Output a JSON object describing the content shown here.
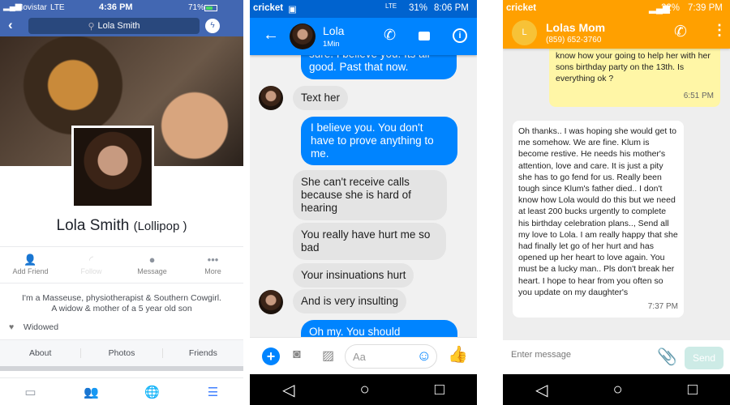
{
  "facebook": {
    "status": {
      "carrier": "Movistar",
      "network": "LTE",
      "time": "4:36 PM",
      "battery": "71%"
    },
    "search": "Lola Smith",
    "profile": {
      "name": "Lola Smith",
      "nickname": "(Lollipop )",
      "bio_line1": "I'm a Masseuse, physiotherapist & Southern Cowgirl.",
      "bio_line2": "A widow & mother of a 5 year old son",
      "relationship": "Widowed"
    },
    "actions": [
      {
        "label": "Add Friend",
        "icon": "add-friend-icon"
      },
      {
        "label": "Follow",
        "icon": "follow-icon"
      },
      {
        "label": "Message",
        "icon": "messenger-icon"
      },
      {
        "label": "More",
        "icon": "more-icon"
      }
    ],
    "tabs": [
      "About",
      "Photos",
      "Friends"
    ],
    "accent": "#4267b2"
  },
  "messenger": {
    "status": {
      "carrier": "cricket",
      "network": "LTE",
      "battery": "31%",
      "time": "8:06 PM"
    },
    "contact": {
      "name": "Lola",
      "presence": "1Min"
    },
    "messages": [
      {
        "from": "me",
        "text": "sure. I believe you. Its all good. Past that now."
      },
      {
        "from": "them",
        "text": "Text her"
      },
      {
        "from": "me",
        "text": "I believe you. You don't have to prove anything to me."
      },
      {
        "from": "them",
        "text": "She can't receive calls because she is hard of hearing"
      },
      {
        "from": "them",
        "text": "You really have hurt me so bad"
      },
      {
        "from": "them",
        "text": "Your insinuations hurt"
      },
      {
        "from": "them",
        "text": "And is very insulting"
      },
      {
        "from": "me",
        "text": "Oh my. You should"
      }
    ],
    "composer_placeholder": "Aa",
    "accent": "#0084ff"
  },
  "sms": {
    "status": {
      "carrier": "cricket",
      "battery": "22%",
      "time": "7:39 PM"
    },
    "contact": {
      "initial": "L",
      "name": "Lolas Mom",
      "phone": "(859) 652-3760"
    },
    "messages": [
      {
        "from": "me",
        "text": "see how you are doing. She wants to know how your going to help her with her sons birthday party on the 13th. Is everything ok ?",
        "time": "6:51 PM"
      },
      {
        "from": "them",
        "text": "Oh thanks.. I was hoping she would get to me somehow. We are fine. Klum is become restive. He needs his mother's attention, love and care. It is just a pity she has to go fend for us. Really been tough since Klum's father died.. I don't know how Lola would do this but we need at least 200 bucks urgently to complete his birthday celebration plans.., Send all my love to Lola. I am really happy that she had finally let go of her hurt and has opened up her heart to love again. You must be a lucky man.. Pls don't break her heart. I hope to hear from you often so you update on my daughter's",
        "time": "7:37 PM"
      }
    ],
    "composer_placeholder": "Enter message",
    "send_label": "Send",
    "accent": "#ffa000"
  }
}
